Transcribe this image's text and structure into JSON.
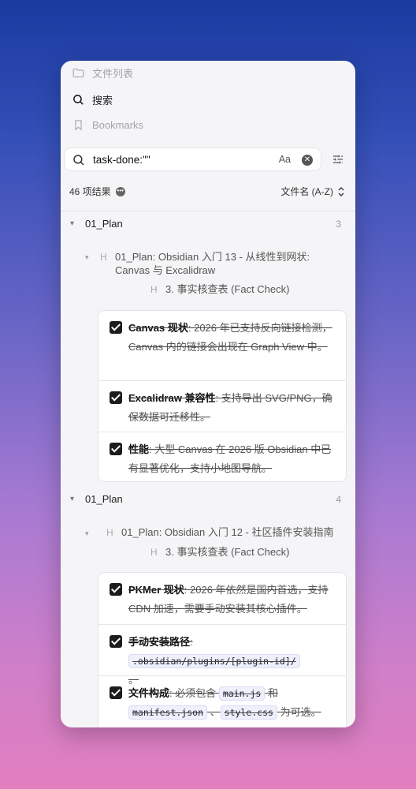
{
  "nav": {
    "files_label": "文件列表",
    "search_label": "搜索",
    "bookmarks_label": "Bookmarks"
  },
  "search": {
    "query": "task-done:\"\"",
    "match_case_label": "Aa"
  },
  "results": {
    "count_label": "46 项结果",
    "sort_label": "文件名 (A-Z)"
  },
  "groups": [
    {
      "file": "01_Plan",
      "count": "3",
      "heading": "01_Plan: Obsidian 入门 13 - 从线性到网状: Canvas 与 Excalidraw",
      "heading_line1": "01_Plan: Obsidian 入门 13 - 从线性到网状:",
      "heading_line2": "Canvas 与 Excalidraw",
      "subheading": "3. 事实核查表 (Fact Check)",
      "tasks": [
        {
          "bold": "Canvas 现状",
          "text": ": 2026 年已支持反向链接检测，Canvas 内的链接会出现在 Graph View 中。"
        },
        {
          "bold": "Excalidraw 兼容性",
          "text": ": 支持导出 SVG/PNG，确保数据可迁移性。"
        },
        {
          "bold": "性能",
          "text": ": 大型 Canvas 在 2026 版 Obsidian 中已有显著优化，支持小地图导航。"
        }
      ]
    },
    {
      "file": "01_Plan",
      "count": "4",
      "heading": "01_Plan: Obsidian 入门 12 - 社区插件安装指南",
      "subheading": "3. 事实核查表 (Fact Check)",
      "tasks": [
        {
          "bold": "PKMer 现状",
          "text": ": 2026 年依然是国内首选，支持 CDN 加速，需要手动安装其核心插件。"
        },
        {
          "bold": "手动安装路径",
          "text": ": ",
          "code": ".obsidian/plugins/[plugin-id]/",
          "tail": " 。"
        },
        {
          "bold": "文件构成",
          "text": ": 必须包含 ",
          "code1": "main.js",
          "mid1": " 和 ",
          "code2": "manifest.json",
          "mid2": " 、",
          "code3": "style.css",
          "tail": " 为可选。"
        }
      ]
    }
  ]
}
